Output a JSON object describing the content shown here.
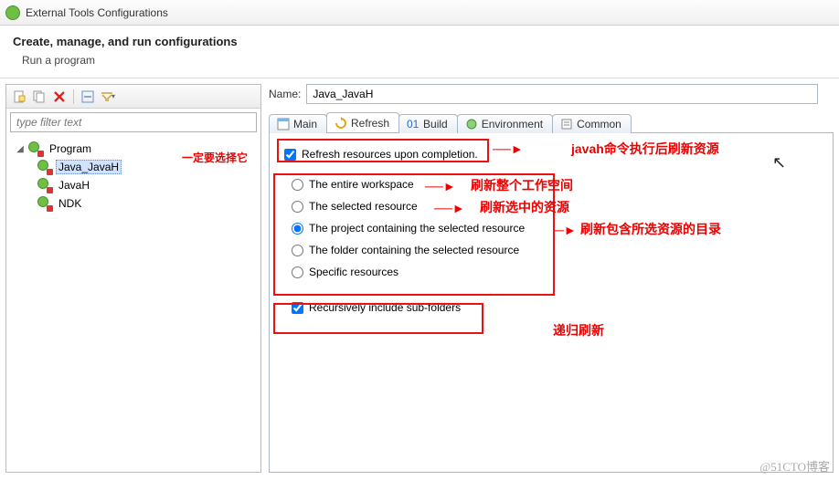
{
  "window": {
    "title": "External Tools Configurations"
  },
  "header": {
    "title": "Create, manage, and run configurations",
    "subtitle": "Run a program"
  },
  "filter": {
    "placeholder": "type filter text"
  },
  "tree": {
    "root": "Program",
    "items": [
      {
        "label": "Java_JavaH",
        "selected": true
      },
      {
        "label": "JavaH",
        "selected": false
      },
      {
        "label": "NDK",
        "selected": false
      }
    ]
  },
  "name": {
    "label": "Name:",
    "value": "Java_JavaH"
  },
  "tabs": {
    "items": [
      {
        "label": "Main"
      },
      {
        "label": "Refresh",
        "active": true
      },
      {
        "label": "Build"
      },
      {
        "label": "Environment"
      },
      {
        "label": "Common"
      }
    ]
  },
  "refresh": {
    "upon_completion": "Refresh resources upon completion.",
    "opt_entire": "The entire workspace",
    "opt_selected_res": "The selected resource",
    "opt_project": "The project containing the selected resource",
    "opt_folder": "The folder containing the selected resource",
    "opt_specific": "Specific resources",
    "recursive": "Recursively include sub-folders"
  },
  "annotations": {
    "must_select": "一定要选择它",
    "after_run": "javah命令执行后刷新资源",
    "entire": "刷新整个工作空间",
    "selected": "刷新选中的资源",
    "project": "刷新包含所选资源的目录",
    "recursive": "递归刷新"
  },
  "watermark": "@51CTO博客"
}
